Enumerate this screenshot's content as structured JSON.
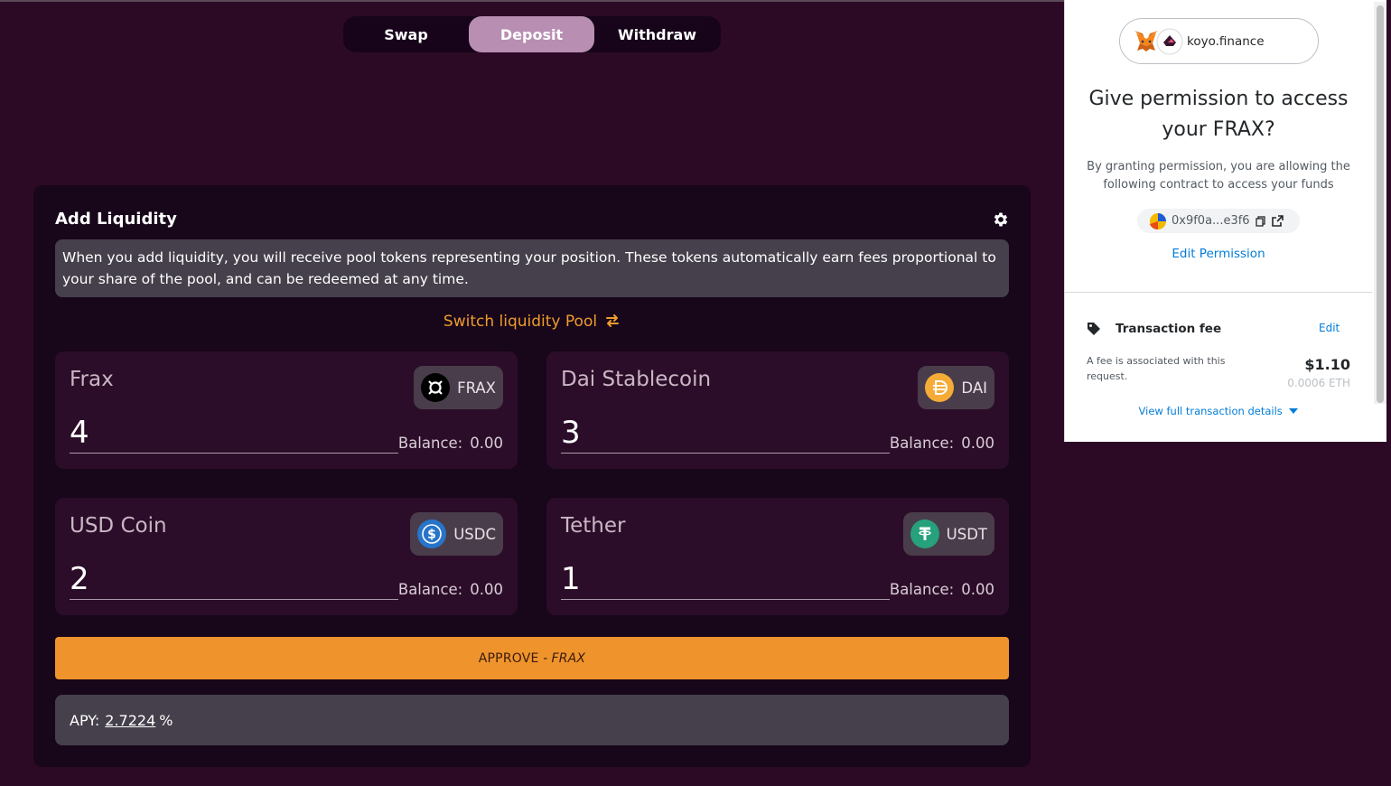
{
  "tabs": [
    {
      "label": "Swap",
      "active": false
    },
    {
      "label": "Deposit",
      "active": true
    },
    {
      "label": "Withdraw",
      "active": false
    }
  ],
  "card": {
    "title": "Add Liquidity",
    "settings_icon": "gear-icon",
    "info_text": "When you add liquidity, you will receive pool tokens representing your position. These tokens automatically earn fees proportional to your share of the pool, and can be redeemed at any time.",
    "switch_label": "Switch liquidity Pool",
    "switch_icon": "swap-arrows-icon"
  },
  "tokens": [
    {
      "name": "Frax",
      "symbol": "FRAX",
      "amount": "4",
      "balance_label": "Balance:",
      "balance": "0.00",
      "icon": "frax-icon",
      "color": "#000000"
    },
    {
      "name": "Dai Stablecoin",
      "symbol": "DAI",
      "amount": "3",
      "balance_label": "Balance:",
      "balance": "0.00",
      "icon": "dai-icon",
      "color": "#f5ac37"
    },
    {
      "name": "USD Coin",
      "symbol": "USDC",
      "amount": "2",
      "balance_label": "Balance:",
      "balance": "0.00",
      "icon": "usdc-icon",
      "color": "#2775ca"
    },
    {
      "name": "Tether",
      "symbol": "USDT",
      "amount": "1",
      "balance_label": "Balance:",
      "balance": "0.00",
      "icon": "tether-icon",
      "color": "#26a17b"
    }
  ],
  "approve": {
    "prefix": "APPROVE -",
    "token": "FRAX"
  },
  "apy": {
    "label": "APY:",
    "value": "2.7224",
    "unit": "%"
  },
  "metamask": {
    "site": "koyo.finance",
    "title": "Give permission to access your FRAX?",
    "description": "By granting permission, you are allowing the following contract to access your funds",
    "address": "0x9f0a...e3f6",
    "edit_permission": "Edit Permission",
    "fee_title": "Transaction fee",
    "fee_edit": "Edit",
    "fee_note": "A fee is associated with this request.",
    "fee_usd": "$1.10",
    "fee_eth": "0.0006 ETH",
    "view_details": "View full transaction details"
  },
  "colors": {
    "background": "#2c0a26",
    "accent": "#ef942d",
    "active_tab": "#b88fb3",
    "link": "#037dd6"
  }
}
